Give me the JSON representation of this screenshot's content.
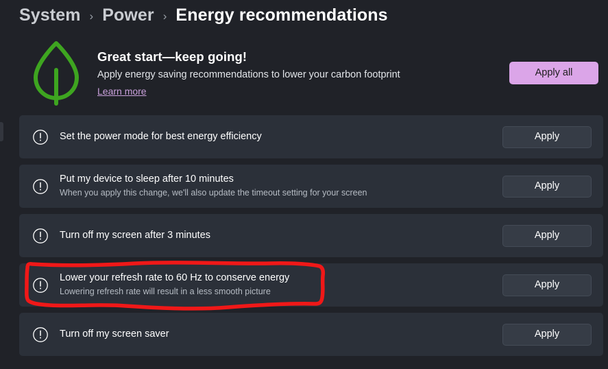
{
  "breadcrumb": {
    "items": [
      {
        "label": "System",
        "current": false
      },
      {
        "label": "Power",
        "current": false
      },
      {
        "label": "Energy recommendations",
        "current": true
      }
    ],
    "separator": "›"
  },
  "hero": {
    "icon": "leaf-icon",
    "icon_color": "#3ea520",
    "title": "Great start—keep going!",
    "subtitle": "Apply energy saving recommendations to lower your carbon footprint",
    "link_label": "Learn more",
    "link_color": "#c9a0db",
    "apply_all_label": "Apply all",
    "apply_all_color": "#dba5e8"
  },
  "recommendations": [
    {
      "icon": "exclamation-circle-icon",
      "title": "Set the power mode for best energy efficiency",
      "subtitle": "",
      "action_label": "Apply",
      "highlighted": false
    },
    {
      "icon": "exclamation-circle-icon",
      "title": "Put my device to sleep after 10 minutes",
      "subtitle": "When you apply this change, we'll also update the timeout setting for your screen",
      "action_label": "Apply",
      "highlighted": false
    },
    {
      "icon": "exclamation-circle-icon",
      "title": "Turn off my screen after 3 minutes",
      "subtitle": "",
      "action_label": "Apply",
      "highlighted": false
    },
    {
      "icon": "exclamation-circle-icon",
      "title": "Lower your refresh rate to 60 Hz to conserve energy",
      "subtitle": "Lowering refresh rate will result in a less smooth picture",
      "action_label": "Apply",
      "highlighted": true
    },
    {
      "icon": "exclamation-circle-icon",
      "title": "Turn off my screen saver",
      "subtitle": "",
      "action_label": "Apply",
      "highlighted": false
    }
  ],
  "annotation": {
    "shape": "hand-drawn-rectangle",
    "color": "#f01818",
    "target": "Lower your refresh rate to 60 Hz to conserve energy"
  },
  "colors": {
    "page_background": "#202228",
    "card_background": "#2b3039",
    "button_background": "#363c46",
    "accent": "#dba5e8",
    "leaf_green": "#3ea520",
    "annotation_red": "#f01818"
  }
}
